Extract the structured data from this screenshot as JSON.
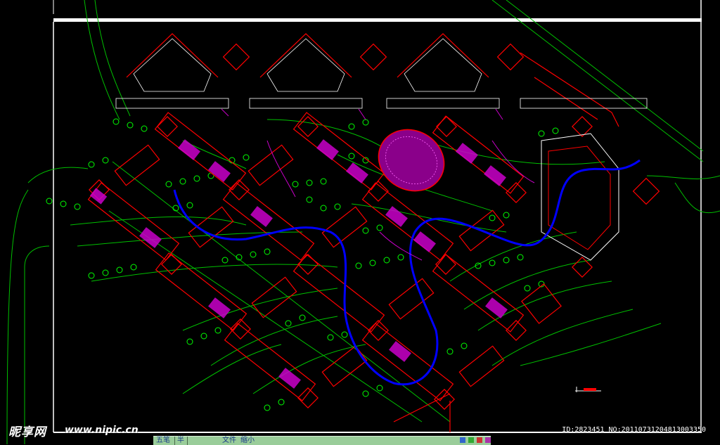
{
  "watermark": {
    "logo": "昵享网",
    "url": "www.nipic.cn",
    "id_line": "ID:2823451 NO:20110731204813003350"
  },
  "statusbar": {
    "item1": "五笔",
    "item2": "半",
    "item3": "文件",
    "item4": "缩小"
  },
  "colors": {
    "background": "#000000",
    "site_outline": "#ff0000",
    "roads": "#00cc00",
    "building_fill": "#cc00cc",
    "river": "#0000ff",
    "frame": "#ffffff",
    "paths": "#cc00cc",
    "trees": "#00ff00"
  }
}
